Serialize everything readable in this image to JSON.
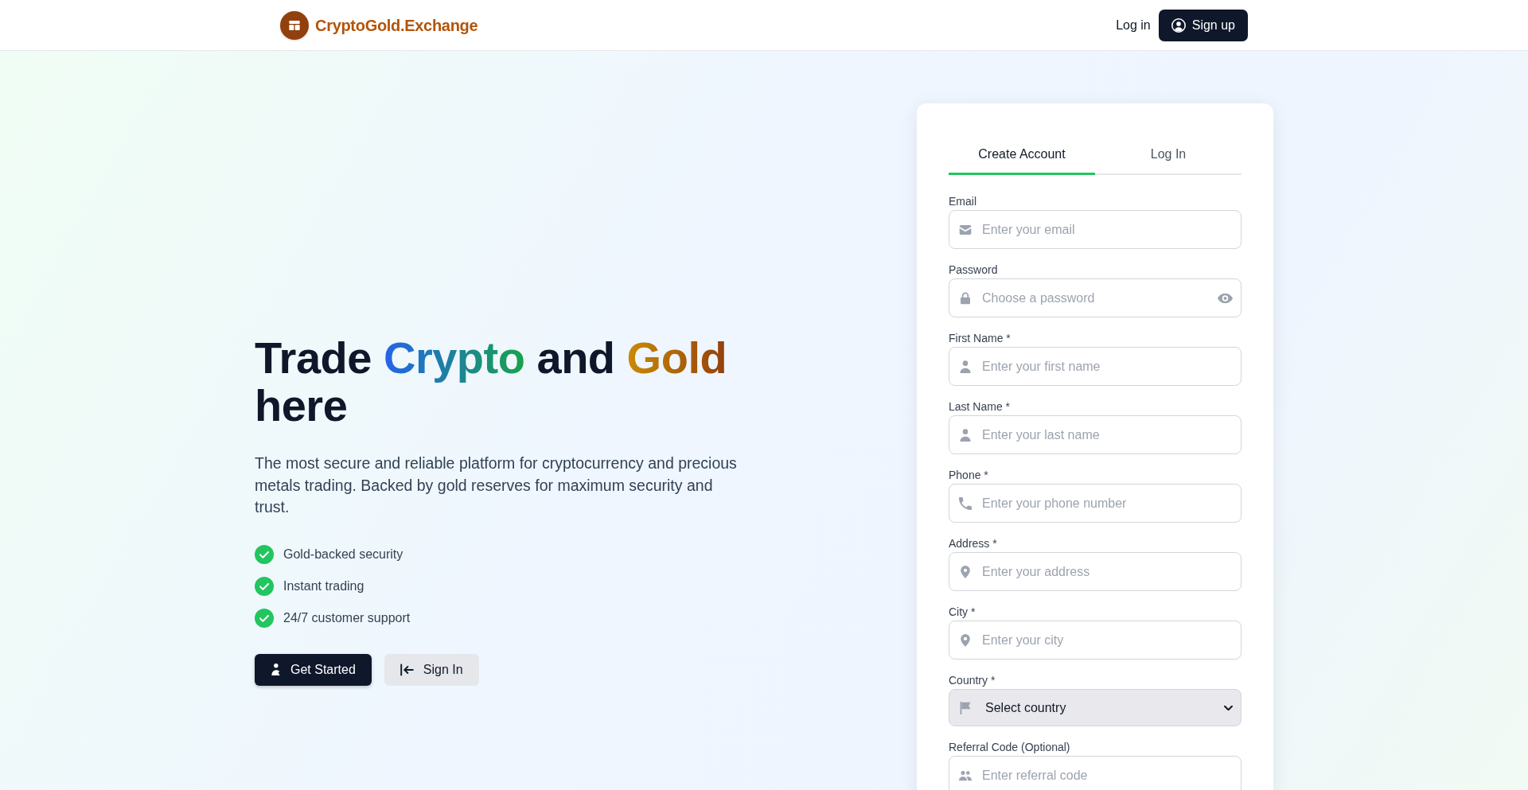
{
  "header": {
    "logo_text": "CryptoGold.Exchange",
    "login_link": "Log in",
    "signup_button": "Sign up"
  },
  "hero": {
    "headline": [
      {
        "text": "Trade ",
        "kind": "plain"
      },
      {
        "text": "Crypto",
        "kind": "cool_gradient"
      },
      {
        "text": " and ",
        "kind": "plain"
      },
      {
        "text": "Gold",
        "kind": "warm_gradient"
      },
      {
        "text": " here",
        "kind": "plain"
      }
    ],
    "description": "The most secure and reliable platform for cryptocurrency and precious metals trading. Backed by gold reserves for maximum security and trust.",
    "features": [
      "Gold-backed security",
      "Instant trading",
      "24/7 customer support"
    ],
    "buttons": [
      {
        "label": "Get Started",
        "kind": "primary"
      },
      {
        "label": "Sign In",
        "kind": "secondary"
      }
    ]
  },
  "signup_form": {
    "tabs": [
      {
        "label": "Create Account",
        "selected": true
      },
      {
        "label": "Log In",
        "selected": false
      }
    ],
    "fields": [
      {
        "kind": "email",
        "label": "Email",
        "placeholder": "Enter your email"
      },
      {
        "kind": "password",
        "label": "Password",
        "placeholder": "Choose a password"
      },
      {
        "kind": "name",
        "label": "First Name *",
        "placeholder": "Enter your first name"
      },
      {
        "kind": "name",
        "label": "Last Name *",
        "placeholder": "Enter your last name"
      },
      {
        "kind": "phone",
        "label": "Phone *",
        "placeholder": "Enter your phone number"
      },
      {
        "kind": "location",
        "label": "Address *",
        "placeholder": "Enter your address"
      },
      {
        "kind": "location",
        "label": "City *",
        "placeholder": "Enter your city"
      },
      {
        "kind": "country",
        "label": "Country *",
        "value": "Select country"
      },
      {
        "kind": "referral",
        "label": "Referral Code (Optional)",
        "placeholder": "Enter referral code"
      }
    ]
  }
}
